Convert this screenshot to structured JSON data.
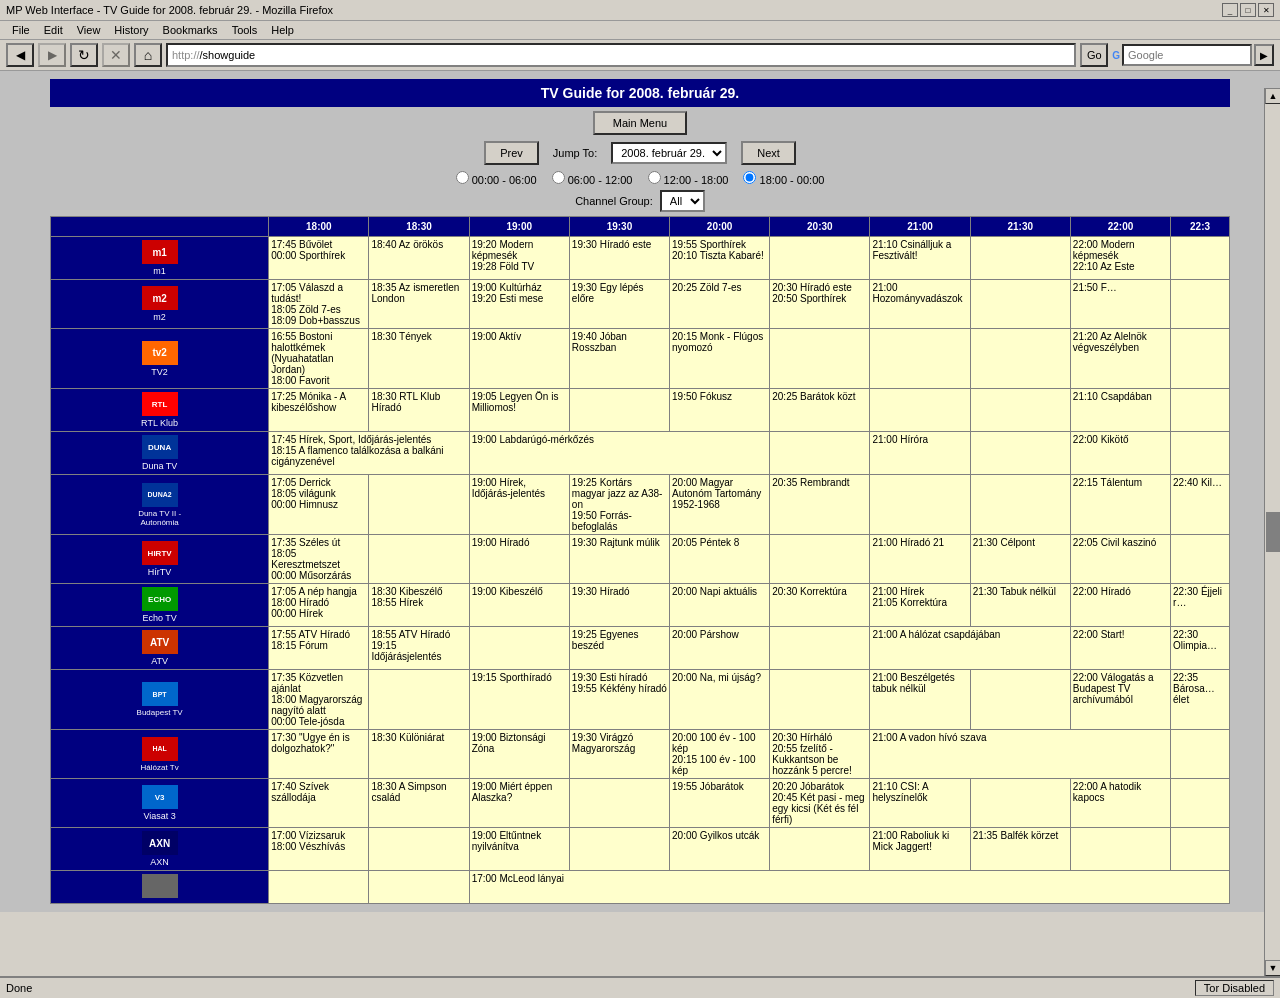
{
  "browser": {
    "title": "MP Web Interface - TV Guide for 2008. február 29. - Mozilla Firefox",
    "url_prefix": "http://",
    "url_path": "/showguide",
    "menu_items": [
      "File",
      "Edit",
      "View",
      "History",
      "Bookmarks",
      "Tools",
      "Help"
    ],
    "search_engine": "Google"
  },
  "page": {
    "title": "TV Guide for 2008. február 29.",
    "main_menu_label": "Main Menu",
    "prev_label": "Prev",
    "next_label": "Next",
    "jump_to_label": "Jump To:",
    "jump_to_value": "2008. február 29.",
    "time_ranges": [
      {
        "label": "00:00 - 06:00",
        "value": "0006"
      },
      {
        "label": "06:00 - 12:00",
        "value": "0612"
      },
      {
        "label": "12:00 - 18:00",
        "value": "1218"
      },
      {
        "label": "18:00 - 00:00",
        "value": "1800",
        "selected": true
      }
    ],
    "channel_group_label": "Channel Group:",
    "channel_group_value": "All",
    "channel_group_options": [
      "All"
    ]
  },
  "time_headers": [
    "18:00",
    "18:30",
    "19:00",
    "19:30",
    "20:00",
    "20:30",
    "21:00",
    "21:30",
    "22:00",
    "22:3"
  ],
  "channels": [
    {
      "id": "m1",
      "logo_class": "logo-m1",
      "name": "m1",
      "programs": "17:45 Bűvölet\n00:00 Sporthírek|18:40 Az örökös|19:20 Modern képmesék\n19:28 Föld TV|19:30 Híradó este||19:55 Sporthírek\n20:10 Tiszta Kabaré!||21:10 Csinálljuk a Fesztivált!||22:00 Modern képmesék\n22:10 Az Este|"
    },
    {
      "id": "m2",
      "logo_class": "logo-m2",
      "name": "m2",
      "programs": "17:05 Válaszd a tudást!\n18:05 Zöld 7-es\n18:09 Dob+basszus|18:35 Az ismeretlen London|19:00 Kultúrház\n19:20 Esti mese|19:30 Egy lépés előre|20:25 Zöld 7-es|20:30 Híradó este\n20:50 Sporthírek|21:00 Hozományvadászok||21:50 F…"
    },
    {
      "id": "tv2",
      "logo_class": "logo-tv2",
      "name": "TV2",
      "programs": "16:55 Bostoni halottkémek\n(Nyuahatatlan Jordan)\n18:00 Favorit|18:30 Tények|19:00 Aktív||19:40 Jóban Rosszban||20:15 Monk - Flúgos nyomozó|||21:20 Az Alelnök végveszélyben|"
    },
    {
      "id": "rtlklub",
      "logo_class": "logo-rtlklub",
      "name": "RTL Klub",
      "programs": "17:25 Mónika - A kibeszélőshow|18:30 RTL Klub Híradó|19:05 Legyen Ön is Milliomos!||19:50 Fókusz|20:25 Barátok közt|||21:10 Csapdában|"
    },
    {
      "id": "dunatv",
      "logo_class": "logo-dunatv",
      "name": "Duna TV",
      "programs": "17:45 Hírek, Sport, Időjárás-jelentés\n18:15 A flamenco találkozása a balkáni cigányzenével|||19:00 Labdarúgó-mérkőzés||||21:00 Híróra||22:00 Kikötő|"
    },
    {
      "id": "dunatv2",
      "logo_class": "logo-dunatv2",
      "name": "Duna TV II - Autonómia",
      "programs": "17:05 Derrick\n18:05 világunk\n00:00 Himnusz||19:00 Hírek, Időjárás-jelentés|19:25 Kortárs magyar jazz az A38-on\n19:50 Forrás-befoglalás|20:00 Magyar Autonóm Tartomány\n1952-1968||20:35 Rembrandt||22:15 Tálentum|22:40 Kil…"
    },
    {
      "id": "hirtv",
      "logo_class": "logo-hirtv",
      "name": "HírTV",
      "programs": "17:35 Széles út\n18:05 Keresztmetszet\n00:00 Műsorzárás||19:00 Híradó|19:30 Rajtunk múlik||20:05 Péntek 8||21:00 Híradó 21|21:30 Célpont||22:05 Civil kaszinó|"
    },
    {
      "id": "echotv",
      "logo_class": "logo-echotv",
      "name": "Echo TV",
      "programs": "17:05 A nép hangja\n18:00 Híradó\n00:00 Hírek|18:30 Kibeszélő\n18:55 Hírek|19:00 Kibeszélő||19:30 Híradó||20:00 Napi aktuális|20:30 Korrektúra|21:00 Hírek\n21:05 Korrektúra|21:30 Tabuk nélkül|22:00 Híradó|22:30 Éjjeli r…"
    },
    {
      "id": "atv",
      "logo_class": "logo-atv",
      "name": "ATV",
      "programs": "17:55 ATV Híradó\n18:15 Fórum|18:55 ATV Híradó\n19:15 Időjárásjelentés|19:25 Egyenes beszéd||20:00 Párshow|||21:00 A hálózat csapdájában||22:00 Start!|22:30 Olimpia…"
    },
    {
      "id": "bptv",
      "logo_class": "logo-bptv",
      "name": "Budapest TV",
      "programs": "17:35 Közvetlen ajánlat\n18:00 Magyarország nagyító alatt\n00:00 Tele-jósda||19:15 Sporthíradó|19:30 Esti híradó\n19:55 Kékfény híradó||20:00 Na, mi újság?|||21:00 Beszélgetés tabuk nélkül||22:00 Válogatás a Budapest TV archívumából|22:35 Bárosa… élet"
    },
    {
      "id": "halozat",
      "logo_class": "logo-halozat",
      "name": "Hálózat Tv",
      "programs": "17:30 \"Ugye én is dolgozhatok?\"||18:30 Különiárat|19:00 Biztonsági Zóna|19:30 Virágzó Magyarország||20:00 100 év - 100 kép\n20:15 100 év - 100 kép|20:30 Hírháló\n20:55 fzelítő - Kukkantson be hozzánk 5 percre!||21:00 A vadon hívó szava|||"
    },
    {
      "id": "viasat3",
      "logo_class": "logo-viasat3",
      "name": "Viasat 3",
      "programs": "17:40 Szívek szállodája|18:30 A Simpson család|19:00 Miért éppen Alaszka?||19:55 Jóbarátok||20:20 Jóbarátok\n20:45 Két pasi - meg egy kicsi (Két és fél férfi)|21:10 CSI: A helyszínelők||22:00 A hatodik kapocs|"
    },
    {
      "id": "axn",
      "logo_class": "logo-axn",
      "name": "AXN",
      "programs": "17:00 Vízizsaruk\n18:00 Vészhívás||19:00 Eltűntnek nyilvánítva||20:00 Gyilkos utcák|||21:00 Raboliuk ki Mick Jaggert!||21:35 Balfék körzet|"
    },
    {
      "id": "extra",
      "logo_class": "logo-m1",
      "name": "",
      "programs": "||17:00 McLeod lányai|||||||||"
    }
  ],
  "statusbar": {
    "status": "Done",
    "tor_status": "Tor Disabled"
  }
}
